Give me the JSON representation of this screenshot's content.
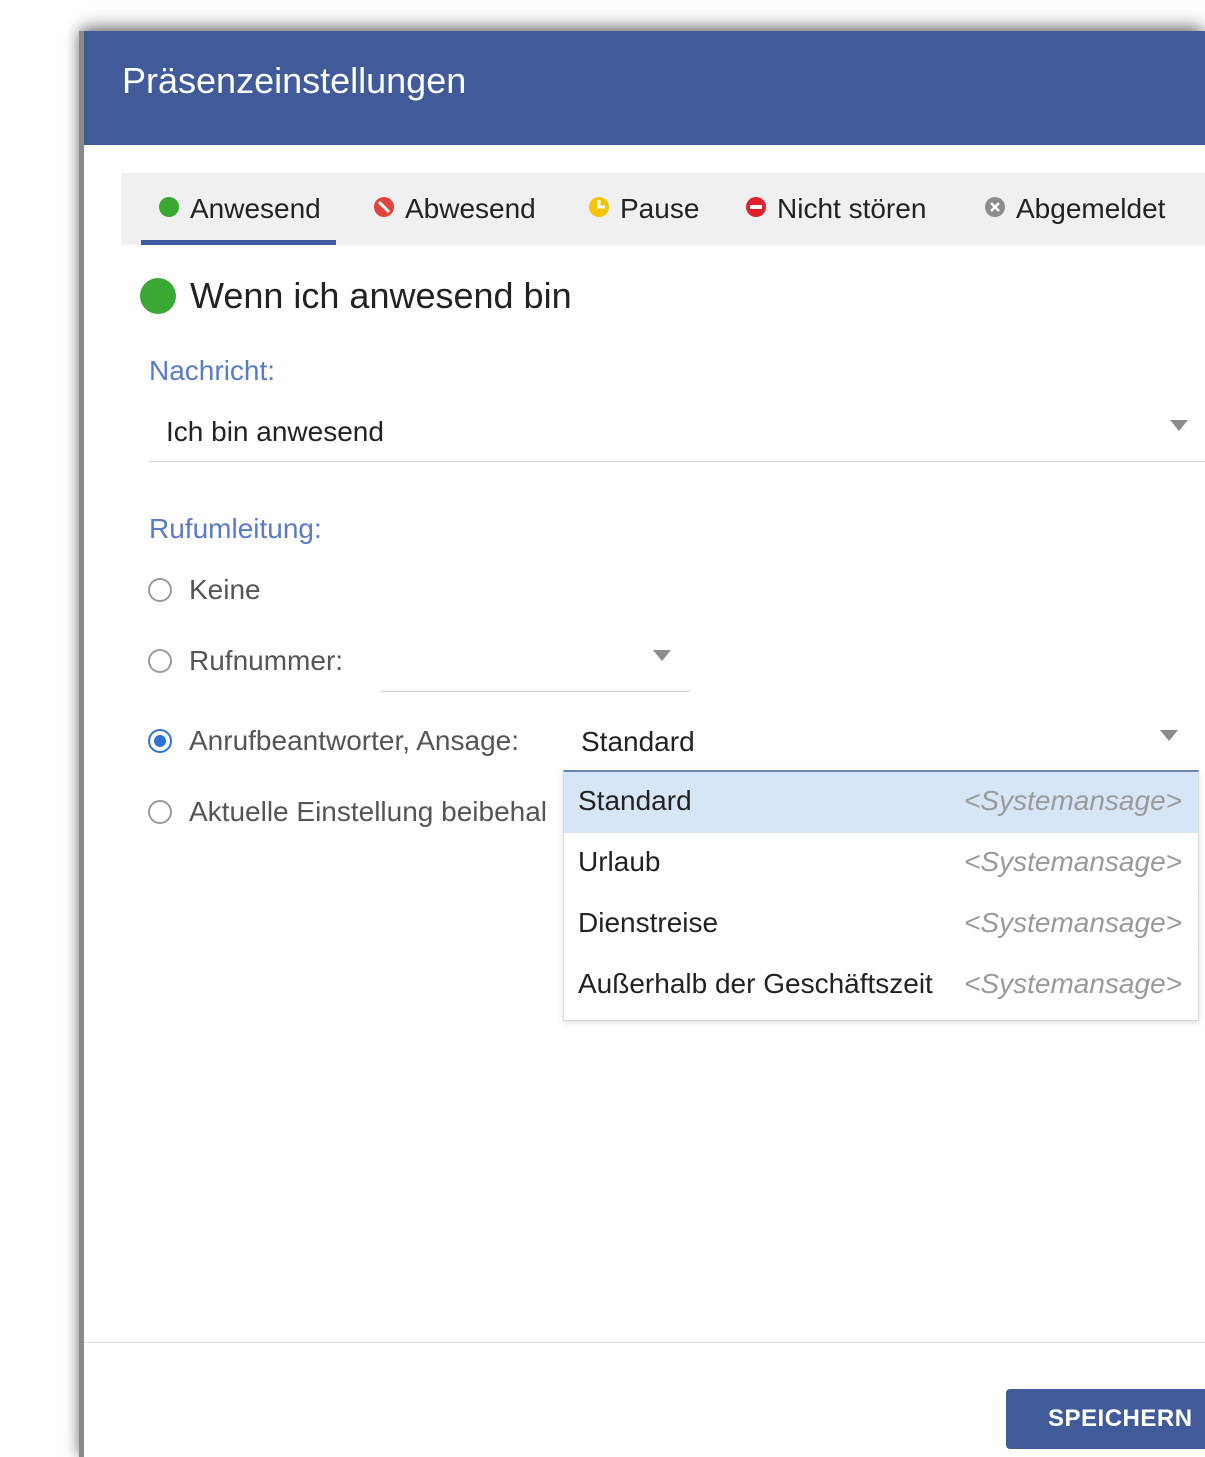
{
  "dialog": {
    "title": "Präsenzeinstellungen"
  },
  "tabs": [
    {
      "label": "Anwesend",
      "icon": "green-dot-icon",
      "color": "#3aa833",
      "active": true
    },
    {
      "label": "Abwesend",
      "icon": "away-icon",
      "color": "#e0443b"
    },
    {
      "label": "Pause",
      "icon": "pause-clock-icon",
      "color": "#f5c400"
    },
    {
      "label": "Nicht stören",
      "icon": "do-not-disturb-icon",
      "color": "#e0202a"
    },
    {
      "label": "Abgemeldet",
      "icon": "signed-out-icon",
      "color": "#8c8c8c"
    }
  ],
  "heading": "Wenn ich anwesend bin",
  "message": {
    "label": "Nachricht:",
    "value": "Ich bin anwesend"
  },
  "forwarding": {
    "label": "Rufumleitung:",
    "options": [
      {
        "label": "Keine",
        "checked": false
      },
      {
        "label": "Rufnummer:",
        "checked": false
      },
      {
        "label": "Anrufbeantworter, Ansage:",
        "checked": true
      },
      {
        "label": "Aktuelle Einstellung beibehal",
        "checked": false
      }
    ],
    "announcement_value": "Standard"
  },
  "announcement_dropdown": [
    {
      "name": "Standard",
      "hint": "<Systemansage>",
      "selected": true
    },
    {
      "name": "Urlaub",
      "hint": "<Systemansage>"
    },
    {
      "name": "Dienstreise",
      "hint": "<Systemansage>"
    },
    {
      "name": "Außerhalb der Geschäftszeit",
      "hint": "<Systemansage>"
    }
  ],
  "footer": {
    "save_label": "SPEICHERN"
  },
  "colors": {
    "accent": "#405a9a",
    "label_blue": "#5a7bc7",
    "selection": "#d7e6f6"
  }
}
